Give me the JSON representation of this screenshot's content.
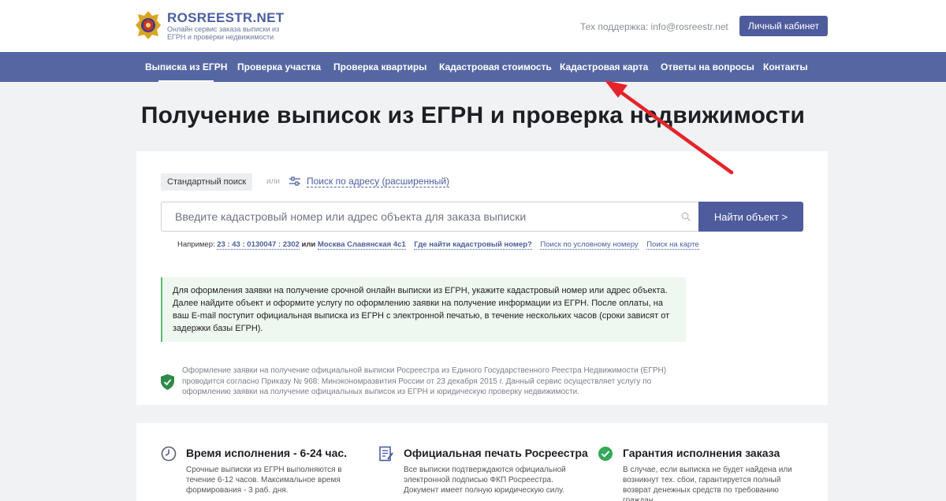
{
  "header": {
    "logo_name": "ROSREESTR.NET",
    "logo_sub": "Онлайн сервис заказа выписки из ЕГРН и проверки недвижимости",
    "support": "Тех поддержка: info@rosreestr.net",
    "cabinet_label": "Личный кабинет"
  },
  "nav": {
    "items": [
      {
        "label": "Выписка из ЕГРН"
      },
      {
        "label": "Проверка участка"
      },
      {
        "label": "Проверка квартиры"
      },
      {
        "label": "Кадастровая стоимость"
      },
      {
        "label": "Кадастровая карта"
      },
      {
        "label": "Ответы на вопросы"
      },
      {
        "label": "Контакты"
      }
    ]
  },
  "page_title": "Получение выписок из ЕГРН и проверка недвижимости",
  "search": {
    "standard_label": "Стандартный поиск",
    "or_label": "или",
    "advanced_label": "Поиск по адресу (расширенный)",
    "placeholder": "Введите кадастровый номер или адрес объекта для заказа выписки",
    "button_label": "Найти объект >",
    "example_prefix": "Например:",
    "example_cadastral": "23 : 43 : 0130047 : 2302",
    "example_or": "или",
    "example_address": "Москва Славянская 4с1",
    "where_number": "Где найти кадастровый номер?",
    "conditional_number": "Поиск по условному номеру",
    "map_search": "Поиск на карте"
  },
  "info_text": "Для оформления заявки на получение срочной онлайн выписки из ЕГРН, укажите кадастровый номер или адрес объекта. Далее найдите объект и оформите услугу по оформлению заявки на получение информации из ЕГРН. После оплаты, на ваш E-mail поступит официальная выписка из ЕГРН с электронной печатью, в течение нескольких часов (сроки зависят от задержки базы ЕГРН).",
  "legal_text": "Оформление заявки на получение официальной выписки Росреестра из Единого Государственного Реестра Недвижимости (ЕГРН) проводится согласно Приказу № 968: Минэкономразвития России от 23 декабря 2015 г. Данный сервис осуществляет услугу по оформлению заявки на получение официальных выписок из ЕГРН и юридическую проверку недвижимости.",
  "features": [
    {
      "icon": "clock-icon",
      "title": "Время исполнения - 6-24 час.",
      "text": "Срочные выписки из ЕГРН выполняются в течение 6-12 часов. Максимальное время формирования - 3 раб. дня."
    },
    {
      "icon": "document-stamp-icon",
      "title": "Официальная печать Росреестра",
      "text": "Все выписки подтверждаются официальной электронной подписью ФКП Росреестра. Документ имеет полную юридическую силу."
    },
    {
      "icon": "check-circle-icon",
      "title": "Гарантия исполнения заказа",
      "text": "В случае, если выписка не будет найдена или возникнут тех. сбои, гарантируется полный возврат денежных средств по требованию граждан."
    }
  ],
  "colors": {
    "brand": "#4e5b9c",
    "nav_bg": "#5567a3",
    "arrow": "#e5232a",
    "info_green": "#5cb874"
  }
}
